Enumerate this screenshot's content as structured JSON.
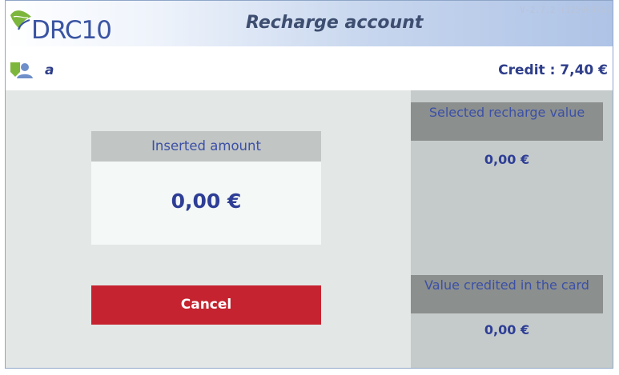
{
  "header": {
    "logo_text": "DRC10",
    "title": "Recharge account",
    "version": "V-2.7.2 (12590376)"
  },
  "user": {
    "name": "a",
    "credit_label": "Credit : 7,40 €"
  },
  "inserted": {
    "label": "Inserted amount",
    "value": "0,00 €"
  },
  "actions": {
    "cancel_label": "Cancel"
  },
  "recharge": {
    "selected_label": "Selected recharge value",
    "selected_value": "0,00  €",
    "credited_label": "Value credited in the card",
    "credited_value": "0,00  €"
  },
  "colors": {
    "accent": "#3c50a6",
    "cancel": "#c5232f",
    "header_gradient_end": "#aec3e6"
  },
  "icons": {
    "logo": "leaf-logo-icon",
    "user": "user-avatar-icon"
  }
}
